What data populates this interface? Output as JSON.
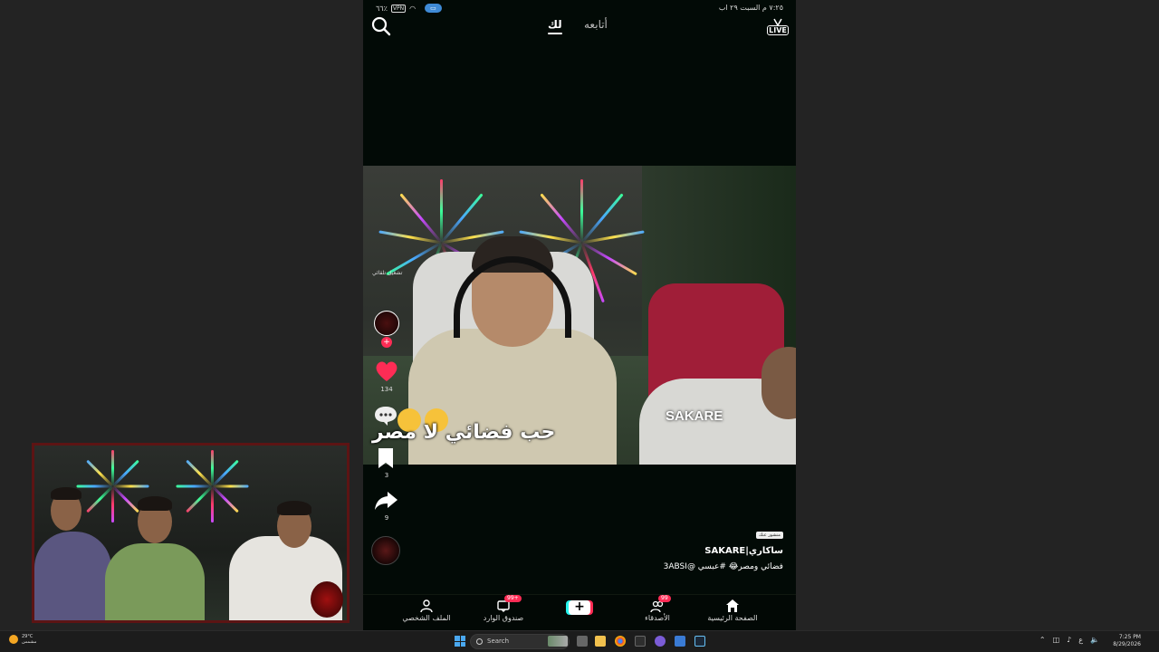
{
  "status_bar": {
    "time_date": "٧:٢٥ م  السبت ٢٩ اب",
    "battery": "٦٦٪",
    "vpn": "VPN",
    "pill": "▭"
  },
  "top_nav": {
    "for_you": "لك",
    "following": "أتابعه",
    "live": "LIVE"
  },
  "video": {
    "caption": "حب فضائي لا مصر",
    "tag": "SAKARE",
    "rail_note": "تشغيل تلقائي"
  },
  "rail": {
    "like_count": "134",
    "save_count": "3",
    "share_count": "9"
  },
  "author": {
    "badge": "منشور عنك",
    "name": "ساكاري|SAKARE",
    "description": "فضائي ومصر😂 #عبسي  @3ABSI"
  },
  "bottom_nav": {
    "home": "الصفحة الرئيسية",
    "friends": "الأصدقاء",
    "friends_badge": "99",
    "inbox": "صندوق الوارد",
    "inbox_badge": "99+",
    "profile": "الملف الشخصي",
    "create": "+"
  },
  "taskbar": {
    "weather_temp": "29°C",
    "weather_desc": "مشمس",
    "search_placeholder": "Search",
    "clock_time": "7:25 PM",
    "clock_date": "8/29/2026",
    "lang": "ع"
  },
  "colors": {
    "accent_red": "#fe2c55",
    "accent_cyan": "#25f4ee",
    "webcam_border": "#5c1414"
  }
}
